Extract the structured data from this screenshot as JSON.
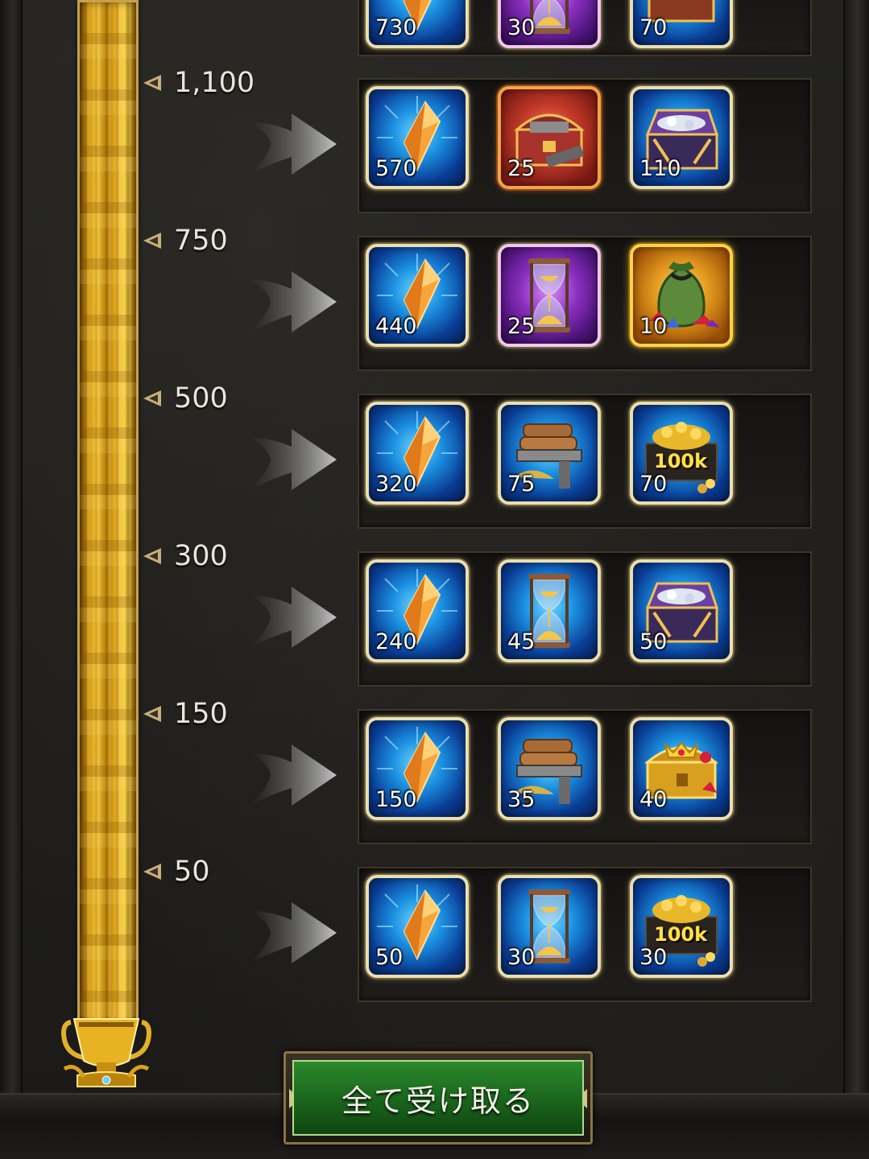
{
  "milestones": [
    {
      "points": "",
      "partial": true,
      "items": [
        {
          "icon": "crystal-icon",
          "frame": "blue",
          "qty": "730"
        },
        {
          "icon": "hourglass-icon",
          "frame": "purple",
          "qty": "30"
        },
        {
          "icon": "gem-chest-icon",
          "frame": "blue",
          "qty": "70"
        }
      ]
    },
    {
      "points": "1,100",
      "items": [
        {
          "icon": "crystal-icon",
          "frame": "blue",
          "qty": "570"
        },
        {
          "icon": "material-chest-icon",
          "frame": "red",
          "qty": "25"
        },
        {
          "icon": "silver-chest-icon",
          "frame": "blue",
          "qty": "110"
        }
      ]
    },
    {
      "points": "750",
      "items": [
        {
          "icon": "crystal-icon",
          "frame": "blue",
          "qty": "440"
        },
        {
          "icon": "hourglass-icon",
          "frame": "purple",
          "qty": "25"
        },
        {
          "icon": "gem-bag-icon",
          "frame": "gold",
          "qty": "10"
        }
      ]
    },
    {
      "points": "500",
      "items": [
        {
          "icon": "crystal-icon",
          "frame": "blue",
          "qty": "320"
        },
        {
          "icon": "lumber-cart-icon",
          "frame": "blue",
          "qty": "75"
        },
        {
          "icon": "gold-coins-icon",
          "frame": "blue",
          "qty": "70",
          "badge": "100k"
        }
      ]
    },
    {
      "points": "300",
      "items": [
        {
          "icon": "crystal-icon",
          "frame": "blue",
          "qty": "240"
        },
        {
          "icon": "hourglass-icon",
          "frame": "blue",
          "qty": "45"
        },
        {
          "icon": "silver-chest-icon",
          "frame": "blue",
          "qty": "50"
        }
      ]
    },
    {
      "points": "150",
      "items": [
        {
          "icon": "crystal-icon",
          "frame": "blue",
          "qty": "150"
        },
        {
          "icon": "lumber-cart-icon",
          "frame": "blue",
          "qty": "35"
        },
        {
          "icon": "ruby-chest-icon",
          "frame": "blue",
          "qty": "40"
        }
      ]
    },
    {
      "points": "50",
      "items": [
        {
          "icon": "crystal-icon",
          "frame": "blue",
          "qty": "50"
        },
        {
          "icon": "hourglass-icon",
          "frame": "blue",
          "qty": "30"
        },
        {
          "icon": "gold-coins-icon",
          "frame": "blue",
          "qty": "30",
          "badge": "100k"
        }
      ]
    }
  ],
  "claim_all_label": "全て受け取る",
  "colors": {
    "gold_bar": "#f3c233",
    "claim_green": "#1d6b1f",
    "frame_cream": "#e9dfb2"
  }
}
